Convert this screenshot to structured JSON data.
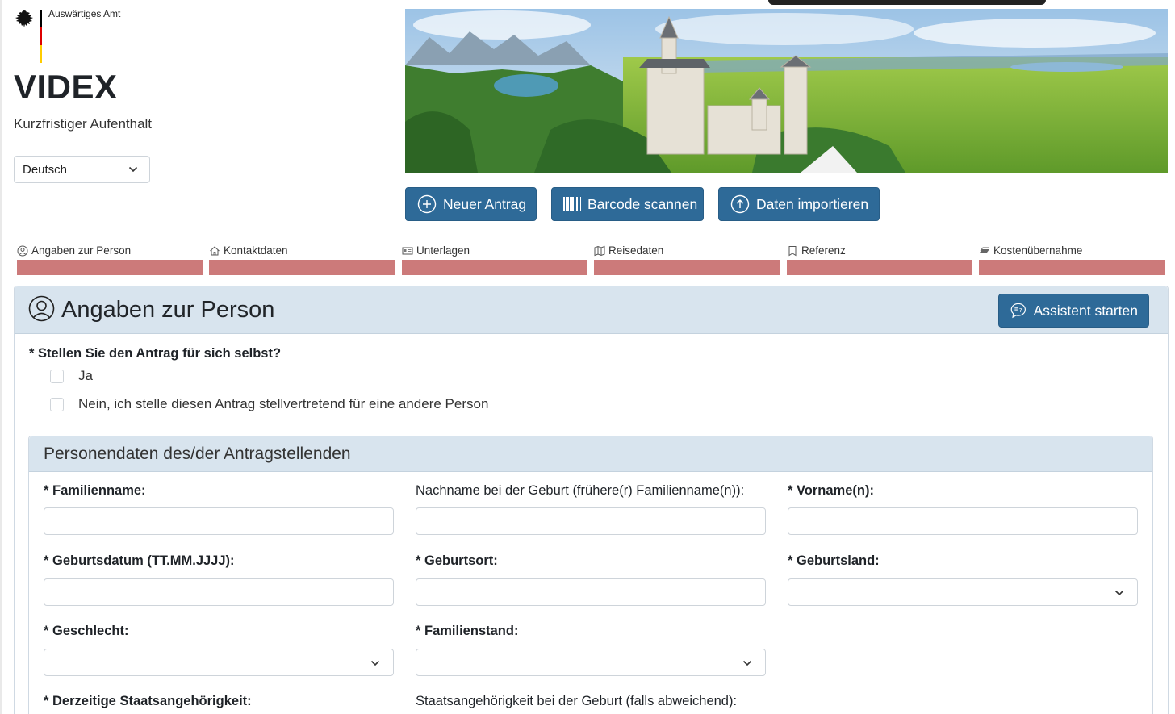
{
  "brand": {
    "name": "Auswärtiges Amt"
  },
  "app": {
    "title": "VIDEX",
    "subtitle": "Kurzfristiger Aufenthalt"
  },
  "language": {
    "selected": "Deutsch"
  },
  "actions": {
    "new_application": "Neuer Antrag",
    "scan_barcode": "Barcode scannen",
    "import_data": "Daten importieren"
  },
  "steps": [
    {
      "label": "Angaben zur Person",
      "icon": "person-circle-icon"
    },
    {
      "label": "Kontaktdaten",
      "icon": "house-icon"
    },
    {
      "label": "Unterlagen",
      "icon": "document-card-icon"
    },
    {
      "label": "Reisedaten",
      "icon": "map-icon"
    },
    {
      "label": "Referenz",
      "icon": "bookmark-icon"
    },
    {
      "label": "Kostenübernahme",
      "icon": "money-icon"
    }
  ],
  "section": {
    "title": "Angaben zur Person",
    "assistant_button": "Assistent starten",
    "question": "* Stellen Sie den Antrag für sich selbst?",
    "options": [
      "Ja",
      "Nein, ich stelle diesen Antrag stellvertretend für eine andere Person"
    ]
  },
  "personal": {
    "title": "Personendaten des/der Antragstellenden",
    "fields": {
      "familienname": "* Familienname:",
      "geburtsname": "Nachname bei der Geburt (frühere(r) Familienname(n)):",
      "vorname": "* Vorname(n):",
      "geburtsdatum": "* Geburtsdatum (TT.MM.JJJJ):",
      "geburtsort": "* Geburtsort:",
      "geburtsland": "* Geburtsland:",
      "geschlecht": "* Geschlecht:",
      "familienstand": "* Familienstand:",
      "staatsangehoerigkeit": "* Derzeitige Staatsangehörigkeit:",
      "staatsangehoerigkeit_geburt": "Staatsangehörigkeit bei der Geburt (falls abweichend):"
    }
  },
  "colors": {
    "primary": "#2e6a98",
    "header_bg": "#d8e4ee",
    "step_bar": "#cc7a7a",
    "flag_black": "#000000",
    "flag_red": "#dd0000",
    "flag_gold": "#ffcc00"
  }
}
